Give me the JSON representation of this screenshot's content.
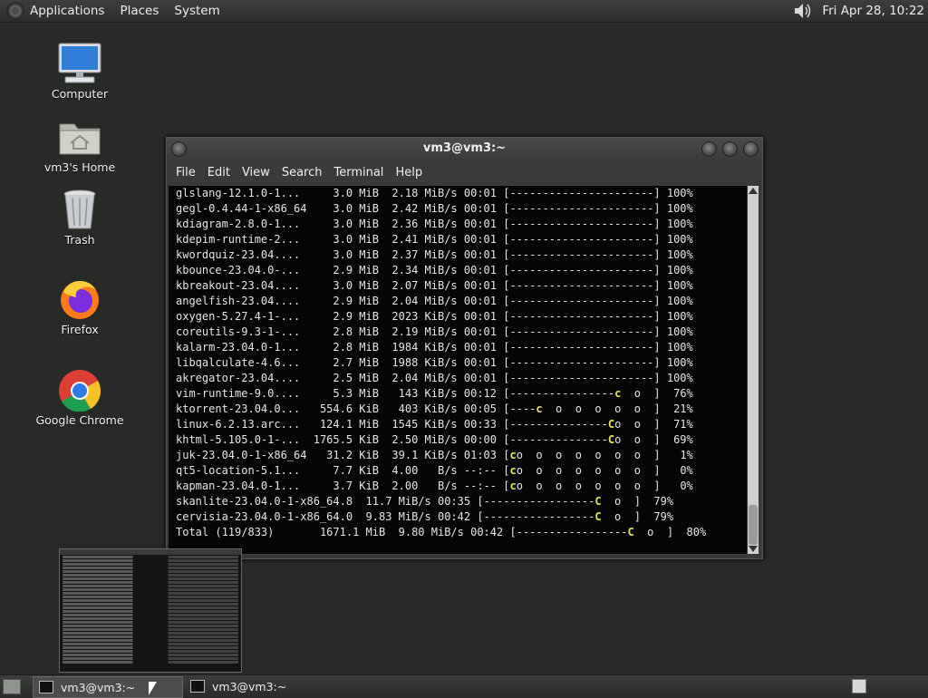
{
  "top_panel": {
    "menus": [
      "Applications",
      "Places",
      "System"
    ],
    "clock": "Fri Apr 28, 10:22"
  },
  "desktop_icons": [
    {
      "label": "Computer",
      "icon": "computer-icon"
    },
    {
      "label": "vm3's Home",
      "icon": "home-folder-icon"
    },
    {
      "label": "Trash",
      "icon": "trash-icon"
    },
    {
      "label": "Firefox",
      "icon": "firefox-icon"
    },
    {
      "label": "Google Chrome",
      "icon": "chrome-icon"
    }
  ],
  "terminal": {
    "title": "vm3@vm3:~",
    "menus": [
      "File",
      "Edit",
      "View",
      "Search",
      "Terminal",
      "Help"
    ],
    "lines": [
      "glslang-12.1.0-1...     3.0 MiB  2.18 MiB/s 00:01 [----------------------] 100%",
      "gegl-0.4.44-1-x86_64    3.0 MiB  2.42 MiB/s 00:01 [----------------------] 100%",
      "kdiagram-2.8.0-1...     3.0 MiB  2.36 MiB/s 00:01 [----------------------] 100%",
      "kdepim-runtime-2...     3.0 MiB  2.41 MiB/s 00:01 [----------------------] 100%",
      "kwordquiz-23.04....     3.0 MiB  2.37 MiB/s 00:01 [----------------------] 100%",
      "kbounce-23.04.0-...     2.9 MiB  2.34 MiB/s 00:01 [----------------------] 100%",
      "kbreakout-23.04....     3.0 MiB  2.07 MiB/s 00:01 [----------------------] 100%",
      "angelfish-23.04....     2.9 MiB  2.04 MiB/s 00:01 [----------------------] 100%",
      "oxygen-5.27.4-1-...     2.9 MiB  2023 KiB/s 00:01 [----------------------] 100%",
      "coreutils-9.3-1-...     2.8 MiB  2.19 MiB/s 00:01 [----------------------] 100%",
      "kalarm-23.04.0-1...     2.8 MiB  1984 KiB/s 00:01 [----------------------] 100%",
      "libqalculate-4.6...     2.7 MiB  1988 KiB/s 00:01 [----------------------] 100%",
      "akregator-23.04....     2.5 MiB  2.04 MiB/s 00:01 [----------------------] 100%",
      "vim-runtime-9.0....     5.3 MiB   143 KiB/s 00:12 [----------------c  o  ]  76%",
      "ktorrent-23.04.0...   554.6 KiB   403 KiB/s 00:05 [----c  o  o  o  o  o  ]  21%",
      "linux-6.2.13.arc...   124.1 MiB  1545 KiB/s 00:33 [---------------Co  o  ]  71%",
      "khtml-5.105.0-1-...  1765.5 KiB  2.50 MiB/s 00:00 [---------------Co  o  ]  69%",
      "juk-23.04.0-1-x86_64   31.2 KiB  39.1 KiB/s 01:03 [co  o  o  o  o  o  o  ]   1%",
      "qt5-location-5.1...     7.7 KiB  4.00   B/s --:-- [co  o  o  o  o  o  o  ]   0%",
      "kapman-23.04.0-1...     3.7 KiB  2.00   B/s --:-- [co  o  o  o  o  o  o  ]   0%",
      "skanlite-23.04.0-1-x86_64.8  11.7 MiB/s 00:35 [-----------------C  o  ]  79%",
      "cervisia-23.04.0-1-x86_64.0  9.83 MiB/s 00:42 [-----------------C  o  ]  79%",
      "Total (119/833)       1671.1 MiB  9.80 MiB/s 00:42 [-----------------C  o  ]  80%"
    ]
  },
  "taskbar": {
    "tasks": [
      {
        "label": "vm3@vm3:~",
        "active": true
      },
      {
        "label": "vm3@vm3:~",
        "active": false
      }
    ]
  }
}
